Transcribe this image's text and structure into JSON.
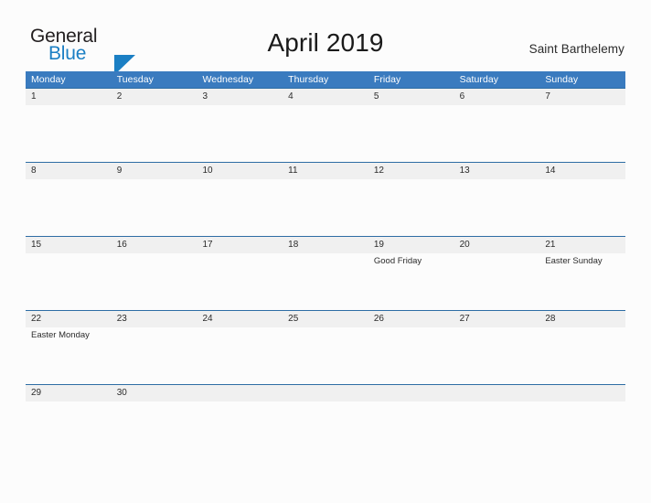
{
  "brand": {
    "name_part1": "General",
    "name_part2": "Blue",
    "flag_icon": "triangle-flag-icon",
    "color_dark": "#231f20",
    "color_blue": "#1b7fc4"
  },
  "header": {
    "title": "April 2019",
    "location": "Saint Barthelemy"
  },
  "calendar": {
    "month": "April",
    "year": "2019",
    "first_day_of_week": "Monday",
    "accent_color": "#3a7bbf",
    "band_color": "#f0f0f0",
    "weekdays": [
      "Monday",
      "Tuesday",
      "Wednesday",
      "Thursday",
      "Friday",
      "Saturday",
      "Sunday"
    ],
    "weeks": [
      {
        "days": [
          {
            "date": "1",
            "event": ""
          },
          {
            "date": "2",
            "event": ""
          },
          {
            "date": "3",
            "event": ""
          },
          {
            "date": "4",
            "event": ""
          },
          {
            "date": "5",
            "event": ""
          },
          {
            "date": "6",
            "event": ""
          },
          {
            "date": "7",
            "event": ""
          }
        ]
      },
      {
        "days": [
          {
            "date": "8",
            "event": ""
          },
          {
            "date": "9",
            "event": ""
          },
          {
            "date": "10",
            "event": ""
          },
          {
            "date": "11",
            "event": ""
          },
          {
            "date": "12",
            "event": ""
          },
          {
            "date": "13",
            "event": ""
          },
          {
            "date": "14",
            "event": ""
          }
        ]
      },
      {
        "days": [
          {
            "date": "15",
            "event": ""
          },
          {
            "date": "16",
            "event": ""
          },
          {
            "date": "17",
            "event": ""
          },
          {
            "date": "18",
            "event": ""
          },
          {
            "date": "19",
            "event": "Good Friday"
          },
          {
            "date": "20",
            "event": ""
          },
          {
            "date": "21",
            "event": "Easter Sunday"
          }
        ]
      },
      {
        "days": [
          {
            "date": "22",
            "event": "Easter Monday"
          },
          {
            "date": "23",
            "event": ""
          },
          {
            "date": "24",
            "event": ""
          },
          {
            "date": "25",
            "event": ""
          },
          {
            "date": "26",
            "event": ""
          },
          {
            "date": "27",
            "event": ""
          },
          {
            "date": "28",
            "event": ""
          }
        ]
      },
      {
        "days": [
          {
            "date": "29",
            "event": ""
          },
          {
            "date": "30",
            "event": ""
          },
          {
            "date": "",
            "event": ""
          },
          {
            "date": "",
            "event": ""
          },
          {
            "date": "",
            "event": ""
          },
          {
            "date": "",
            "event": ""
          },
          {
            "date": "",
            "event": ""
          }
        ]
      }
    ]
  }
}
